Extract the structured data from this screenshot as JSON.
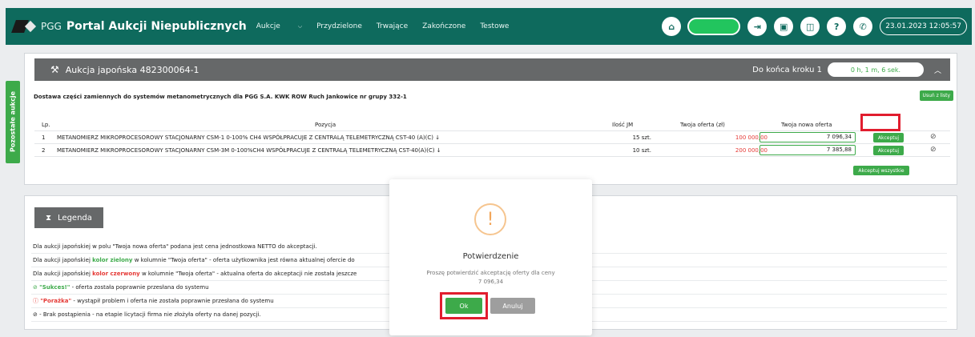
{
  "header": {
    "brand_prefix": "PGG",
    "brand_title": "Portal Aukcji Niepublicznych",
    "nav": [
      "Aukcje",
      "Przydzielone",
      "Trwające",
      "Zakończone",
      "Testowe"
    ],
    "datetime": "23.01.2023 12:05:57",
    "icons": [
      "home-icon",
      "exit-icon",
      "save-icon",
      "book-icon",
      "help-icon",
      "phone-icon"
    ]
  },
  "side_tab": "Pozostałe aukcje",
  "auction": {
    "title": "Aukcja japońska 482300064-1",
    "step_label": "Do końca kroku 1",
    "timer": "0 h, 1 m, 6 sek.",
    "subject": "Dostawa części zamiennych do systemów metanometrycznych dla PGG S.A. KWK ROW Ruch Jankowice nr grupy 332-1",
    "remove_label": "Usuń z listy",
    "columns": [
      "Lp.",
      "Pozycja",
      "Ilość JM",
      "Twoja oferta (zł)",
      "Twoja nowa oferta"
    ],
    "rows": [
      {
        "lp": "1",
        "item": "METANOMIERZ MIKROPROCESOROWY STACJONARNY CSM-1 0-100% CH4 WSPÓŁPRACUJE Z CENTRALĄ TELEMETRYCZNĄ CST-40 (A)(C) ↓",
        "qty": "15 szt.",
        "offer": "100 000,00",
        "new_offer": "7 096,34",
        "accept": "Akceptuj"
      },
      {
        "lp": "2",
        "item": "METANOMIERZ MIKROPROCESOROWY STACJONARNY CSM-3M 0-100%CH4 WSPÓŁPRACUJE Z CENTRALĄ TELEMETRYCZNĄ CST-40(A)(C) ↓",
        "qty": "10 szt.",
        "offer": "200 000,00",
        "new_offer": "7 385,88",
        "accept": "Akceptuj"
      }
    ],
    "accept_all": "Akceptuj wszystkie"
  },
  "legend": {
    "title": "Legenda",
    "lines": {
      "l1": "Dla aukcji japońskiej w polu \"Twoja nowa oferta\" podana jest cena jednostkowa NETTO do akceptacji.",
      "l2_pre": "Dla aukcji japońskiej ",
      "l2_bold": "kolor zielony",
      "l2_post": " w kolumnie \"Twoja oferta\" - oferta użytkownika jest równa aktualnej ofercie do",
      "l3_pre": "Dla aukcji japońskiej ",
      "l3_bold": "kolor czerwony",
      "l3_post": " w kolumnie \"Twoja oferta\" - aktualna oferta do akceptacji nie została jeszcze",
      "l4_icon": "⊘",
      "l4_bold": "\"Sukces!\"",
      "l4_post": " - oferta została poprawnie przesłana do systemu",
      "l5_icon": "ⓘ",
      "l5_bold": "\"Porażka\"",
      "l5_post": " - wystąpił problem i oferta nie została poprawnie przesłana do systemu",
      "l6_icon": "⊘",
      "l6_post": " - Brak postąpienia - na etapie licytacji firma nie złożyła oferty na danej pozycji."
    }
  },
  "modal": {
    "icon": "!",
    "title": "Potwierdzenie",
    "text": "Proszę potwierdzić akceptację oferty dla ceny",
    "price": "7 096,34",
    "ok": "Ok",
    "cancel": "Anuluj"
  }
}
